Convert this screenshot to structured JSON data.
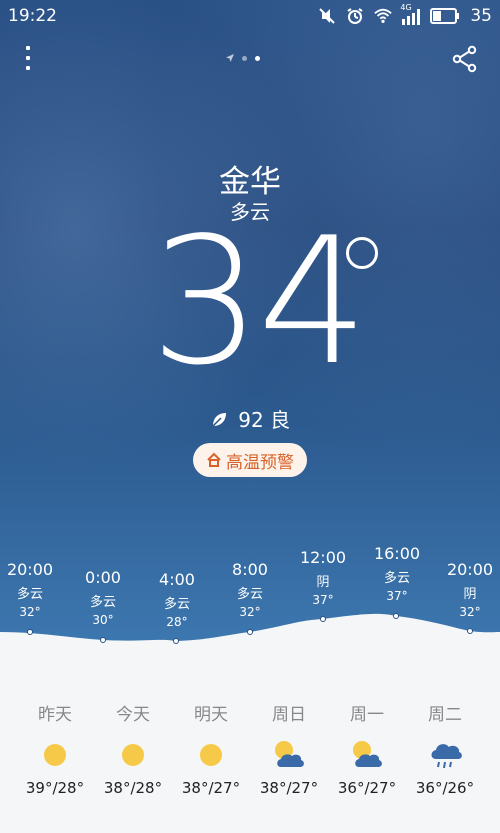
{
  "status_bar": {
    "time": "19:22",
    "battery": "35",
    "network_type": "4G"
  },
  "city": "金华",
  "condition": "多云",
  "temperature": "34",
  "aqi": {
    "value": "92",
    "label": "良",
    "text": "92 良"
  },
  "alert": {
    "label": "高温预警"
  },
  "hourly": [
    {
      "time": "20:00",
      "cond": "多云",
      "temp": "32°"
    },
    {
      "time": "0:00",
      "cond": "多云",
      "temp": "30°"
    },
    {
      "time": "4:00",
      "cond": "多云",
      "temp": "28°"
    },
    {
      "time": "8:00",
      "cond": "多云",
      "temp": "32°"
    },
    {
      "time": "12:00",
      "cond": "阴",
      "temp": "37°"
    },
    {
      "time": "16:00",
      "cond": "多云",
      "temp": "37°"
    },
    {
      "time": "20:00",
      "cond": "阴",
      "temp": "32°"
    }
  ],
  "daily": [
    {
      "name": "昨天",
      "icon": "sun-icon",
      "range": "39°/28°"
    },
    {
      "name": "今天",
      "icon": "sun-icon",
      "range": "38°/28°"
    },
    {
      "name": "明天",
      "icon": "sun-icon",
      "range": "38°/27°"
    },
    {
      "name": "周日",
      "icon": "partly-cloudy-icon",
      "range": "38°/27°"
    },
    {
      "name": "周一",
      "icon": "partly-cloudy-icon",
      "range": "36°/27°"
    },
    {
      "name": "周二",
      "icon": "rain-cloud-icon",
      "range": "36°/26°"
    }
  ],
  "colors": {
    "sky_top": "#2a5186",
    "sky_bottom": "#3d78b0",
    "alert_text": "#d9622b",
    "sun": "#f7c948",
    "cloud": "#3b6aa8"
  }
}
